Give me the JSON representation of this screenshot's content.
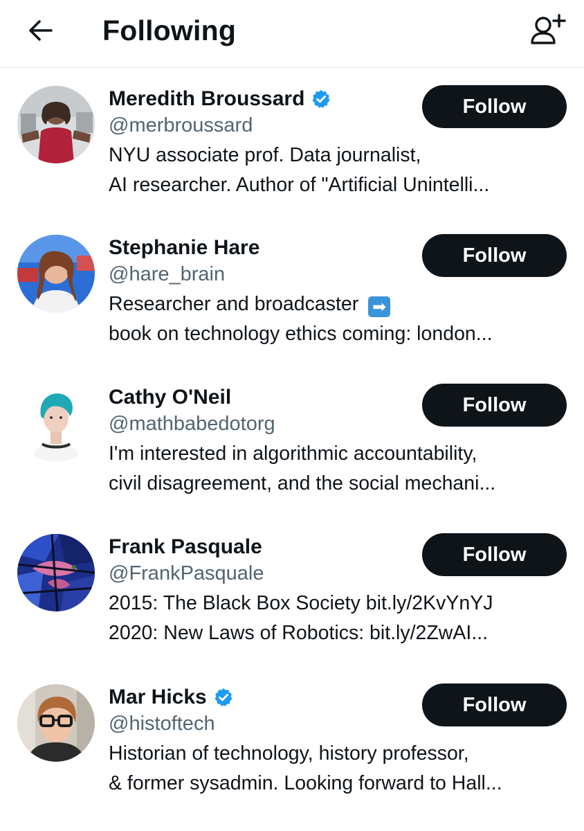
{
  "header": {
    "back_icon": "arrow-left-icon",
    "title": "Following",
    "add_user_icon": "add-user-icon"
  },
  "accent_color": "#1d9bf0",
  "button_color": "#0f1419",
  "users": [
    {
      "name": "Meredith Broussard",
      "verified": true,
      "handle": "@merbroussard",
      "bio_line1": "NYU associate prof. Data journalist,",
      "bio_line2": "AI researcher. Author of \"Artificial Unintelli...",
      "follow_label": "Follow"
    },
    {
      "name": "Stephanie Hare",
      "verified": false,
      "handle": "@hare_brain",
      "bio_line1": "Researcher and broadcaster",
      "bio_line1_emoji": "➡",
      "bio_line2": "book on technology ethics coming: london...",
      "follow_label": "Follow"
    },
    {
      "name": "Cathy O'Neil",
      "verified": false,
      "handle": "@mathbabedotorg",
      "bio_line1": "I'm interested in algorithmic accountability,",
      "bio_line2": "civil disagreement, and the social mechani...",
      "follow_label": "Follow"
    },
    {
      "name": "Frank Pasquale",
      "verified": false,
      "handle": "@FrankPasquale",
      "bio_line1": "2015: The Black Box Society bit.ly/2KvYnYJ",
      "bio_line2": "2020: New Laws of Robotics: bit.ly/2ZwAI...",
      "follow_label": "Follow"
    },
    {
      "name": "Mar Hicks",
      "verified": true,
      "handle": "@histoftech",
      "bio_line1": "Historian of technology, history professor,",
      "bio_line2": "& former sysadmin. Looking forward to Hall...",
      "follow_label": "Follow"
    }
  ]
}
